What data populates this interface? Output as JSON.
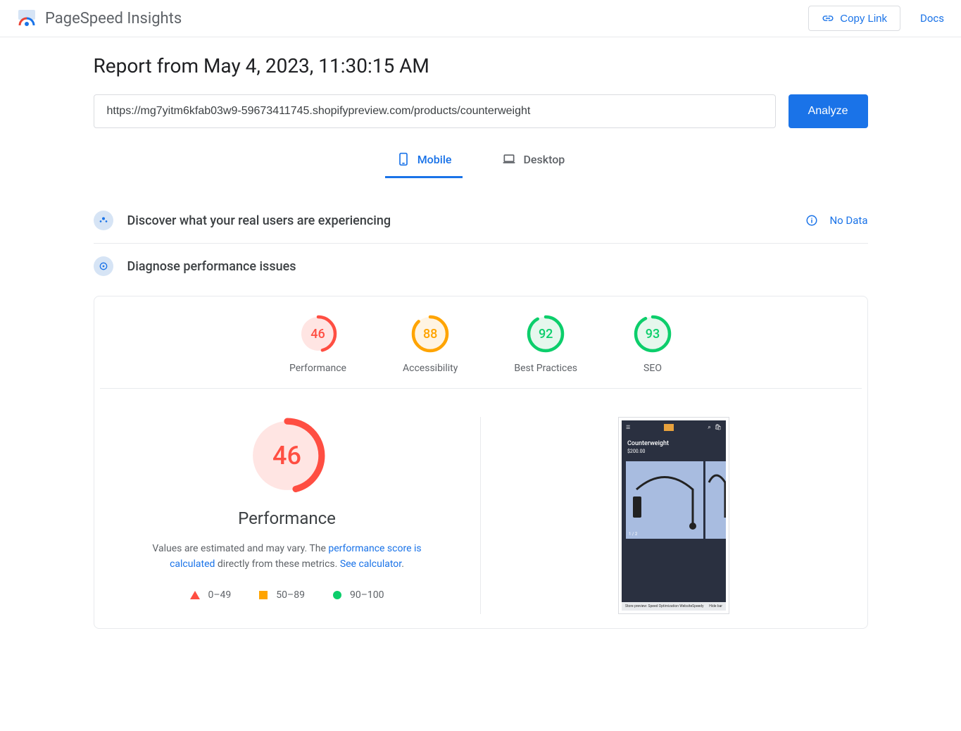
{
  "header": {
    "title": "PageSpeed Insights",
    "copy_link": "Copy Link",
    "docs": "Docs"
  },
  "report": {
    "title": "Report from May 4, 2023, 11:30:15 AM",
    "url": "https://mg7yitm6kfab03w9-59673411745.shopifypreview.com/products/counterweight",
    "analyze": "Analyze"
  },
  "tabs": {
    "mobile": "Mobile",
    "desktop": "Desktop"
  },
  "discover": {
    "title": "Discover what your real users are experiencing",
    "no_data": "No Data"
  },
  "diagnose": {
    "title": "Diagnose performance issues"
  },
  "gauges": [
    {
      "score": 46,
      "label": "Performance",
      "color": "red"
    },
    {
      "score": 88,
      "label": "Accessibility",
      "color": "orange"
    },
    {
      "score": 92,
      "label": "Best Practices",
      "color": "green"
    },
    {
      "score": 93,
      "label": "SEO",
      "color": "green"
    }
  ],
  "performance": {
    "score": 46,
    "label": "Performance",
    "desc_pre": "Values are estimated and may vary. The ",
    "desc_link1": "performance score is calculated",
    "desc_mid": " directly from these metrics. ",
    "desc_link2": "See calculator",
    "desc_end": "."
  },
  "legend": {
    "bad": "0–49",
    "mid": "50–89",
    "good": "90–100"
  },
  "screenshot": {
    "product_title": "Counterweight",
    "price": "$200.00",
    "indicator": "1 / 2",
    "preview_text": "Store preview: Speed Optimization WebsiteSpeedy",
    "hide": "Hide bar"
  }
}
